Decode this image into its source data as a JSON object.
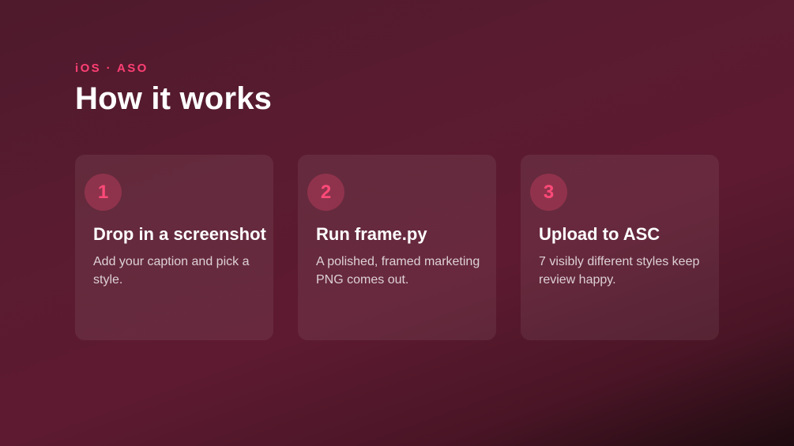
{
  "header": {
    "eyebrow": "iOS · ASO",
    "title": "How it works"
  },
  "steps": [
    {
      "number": "1",
      "title": "Drop in a screenshot",
      "description": "Add your caption and pick a style."
    },
    {
      "number": "2",
      "title": "Run frame.py",
      "description": "A polished, framed marketing PNG comes out."
    },
    {
      "number": "3",
      "title": "Upload to ASC",
      "description": "7 visibly different styles keep review happy."
    }
  ],
  "colors": {
    "accent": "#ff4a78",
    "background": "#5a1b30",
    "text": "#ffffff"
  }
}
